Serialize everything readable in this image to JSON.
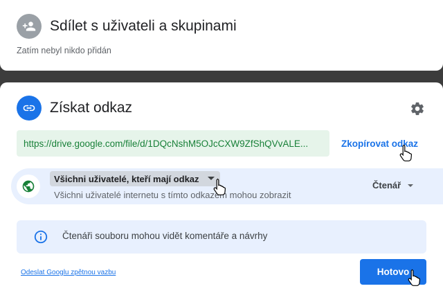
{
  "share_section": {
    "icon": "person-add-icon",
    "title": "Sdílet s uživateli a skupinami",
    "subtitle": "Zatím nebyl nikdo přidán"
  },
  "link_section": {
    "icon": "link-icon",
    "title": "Získat odkaz",
    "settings_icon": "gear-icon",
    "url": "https://drive.google.com/file/d/1DQcNshM5OJcCXW9ZfShQVvALE...",
    "copy_label": "Zkopírovat odkaz",
    "access": {
      "icon": "globe-icon",
      "scope_label": "Všichni uživatelé, kteří mají odkaz",
      "scope_description": "Všichni uživatelé internetu s tímto odkazem mohou zobrazit",
      "role_label": "Čtenář"
    },
    "info": {
      "icon": "info-icon",
      "text": "Čtenáři souboru mohou vidět komentáře a návrhy"
    },
    "feedback_label": "Odeslat Googlu zpětnou vazbu",
    "done_label": "Hotovo"
  },
  "colors": {
    "accent": "#1a73e8",
    "url_text": "#188038",
    "url_background": "#e6f4ea",
    "highlight_background": "#e8f0fe",
    "backdrop": "#3c3c3c"
  },
  "cursors": [
    "hand-pointer-icon",
    "hand-pointer-icon",
    "hand-pointer-icon"
  ]
}
